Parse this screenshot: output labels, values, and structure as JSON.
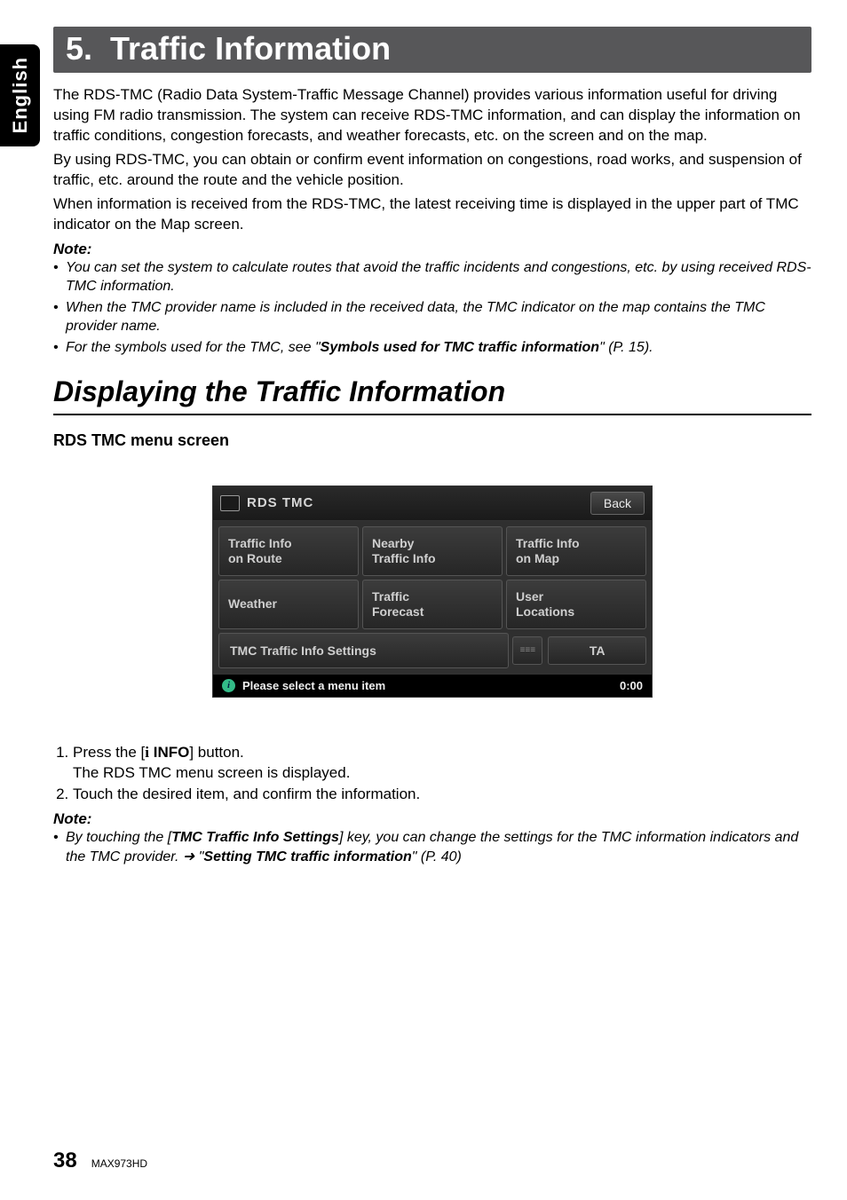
{
  "side_tab": "English",
  "chapter": {
    "number": "5.",
    "title": "Traffic Information"
  },
  "intro": {
    "p1": "The RDS-TMC (Radio Data System-Traffic Message Channel) provides various information useful for driving using FM radio transmission. The system can receive RDS-TMC information, and can display the information on traffic conditions, congestion forecasts, and weather forecasts, etc. on the screen and on the map.",
    "p2": "By using RDS-TMC, you can obtain or confirm event information on congestions, road works, and suspension of traffic, etc. around the route and the vehicle position.",
    "p3": "When information is received from the RDS-TMC, the latest receiving time is displayed in the upper part of TMC indicator on the Map screen."
  },
  "note1": {
    "label": "Note:",
    "items": [
      {
        "text": "You can set the system to calculate routes that avoid the traffic incidents and congestions, etc. by using received RDS-TMC information."
      },
      {
        "text": "When the TMC provider name is included in the received data, the TMC indicator on the map contains the TMC provider name."
      },
      {
        "prefix": "For the symbols used for the TMC, see \"",
        "bold": "Symbols used for TMC traffic information",
        "suffix": "\" (P. 15)."
      }
    ]
  },
  "section": {
    "title": "Displaying the Traffic Information"
  },
  "subheading": "RDS TMC menu screen",
  "screenshot": {
    "title": "RDS TMC",
    "back": "Back",
    "buttons": [
      {
        "l1": "Traffic Info",
        "l2": "on Route"
      },
      {
        "l1": "Nearby",
        "l2": "Traffic Info"
      },
      {
        "l1": "Traffic Info",
        "l2": "on Map"
      },
      {
        "l1": "Weather",
        "l2": ""
      },
      {
        "l1": "Traffic",
        "l2": "Forecast"
      },
      {
        "l1": "User",
        "l2": "Locations"
      }
    ],
    "settings": "TMC Traffic Info Settings",
    "ta": "TA",
    "status": "Please select a menu item",
    "time": "0:00"
  },
  "steps": {
    "s1a": "Press the [",
    "s1_icon": "i",
    "s1_bold": " INFO",
    "s1b": "] button.",
    "s1_sub": "The RDS TMC menu screen is displayed.",
    "s2": "Touch the desired item, and confirm the information."
  },
  "note2": {
    "label": "Note:",
    "prefix": "By touching the [",
    "bold1": "TMC Traffic Info Settings",
    "mid": "] key, you can change the settings for the TMC information indicators and the TMC provider. ➜ \"",
    "bold2": "Setting TMC traffic information",
    "suffix": "\" (P. 40)"
  },
  "footer": {
    "page": "38",
    "model": "MAX973HD"
  }
}
